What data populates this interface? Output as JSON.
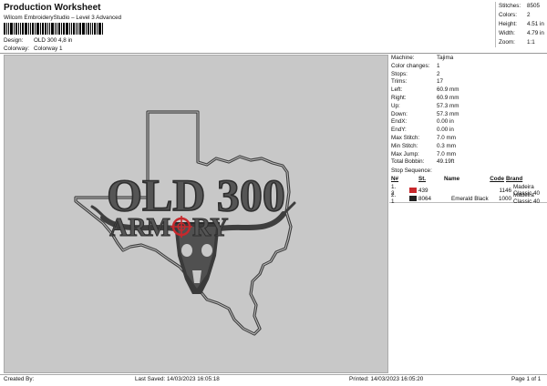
{
  "header": {
    "title": "Production Worksheet",
    "subtitle": "Wilcom EmbroideryStudio – Level 3 Advanced",
    "design_label": "Design:",
    "design_value": "OLD 300 4,8 in",
    "colorway_label": "Colorway:",
    "colorway_value": "Colorway 1"
  },
  "stats": [
    {
      "label": "Stitches:",
      "value": "8505"
    },
    {
      "label": "Colors:",
      "value": "2"
    },
    {
      "label": "Height:",
      "value": "4.51 in"
    },
    {
      "label": "Width:",
      "value": "4.79 in"
    },
    {
      "label": "Zoom:",
      "value": "1:1"
    }
  ],
  "params": [
    {
      "label": "Machine:",
      "value": "Tajima"
    },
    {
      "label": "Color changes:",
      "value": "1"
    },
    {
      "label": "Stops:",
      "value": "2"
    },
    {
      "label": "Trims:",
      "value": "17"
    },
    {
      "label": "Left:",
      "value": "60.9 mm"
    },
    {
      "label": "Right:",
      "value": "60.9 mm"
    },
    {
      "label": "Up:",
      "value": "57.3 mm"
    },
    {
      "label": "Down:",
      "value": "57.3 mm"
    },
    {
      "label": "EndX:",
      "value": "0.00 in"
    },
    {
      "label": "EndY:",
      "value": "0.00 in"
    },
    {
      "label": "Max Stitch:",
      "value": "7.0 mm"
    },
    {
      "label": "Min Stitch:",
      "value": "0.3 mm"
    },
    {
      "label": "Max Jump:",
      "value": "7.0 mm"
    },
    {
      "label": "Total Bobbin:",
      "value": "49.19ft"
    }
  ],
  "stop_sequence": {
    "title": "Stop Sequence:",
    "headers": {
      "num": "N#",
      "st": "St.",
      "name": "Name",
      "code": "Code",
      "brand": "Brand"
    },
    "rows": [
      {
        "n": "1.",
        "stop": "2",
        "color": "#c8282c",
        "st": "439",
        "name": "",
        "code": "1146",
        "brand": "Madeira Classic 40"
      },
      {
        "n": "2.",
        "stop": "1",
        "color": "#222222",
        "st": "8064",
        "name": "Emerald Black",
        "code": "1000",
        "brand": "Madeira Classic 40"
      }
    ]
  },
  "design": {
    "line1": "OLD 300",
    "line2_left": "ARM",
    "line2_right": "RY",
    "thread_dark": "#3e3e3e",
    "thread_red": "#c8282c",
    "background": "#c8c8c8"
  },
  "footer": {
    "created": "Created By:",
    "saved": "Last Saved: 14/03/2023 16:05:18",
    "printed": "Printed: 14/03/2023 16:05:20",
    "page": "Page 1 of 1"
  }
}
